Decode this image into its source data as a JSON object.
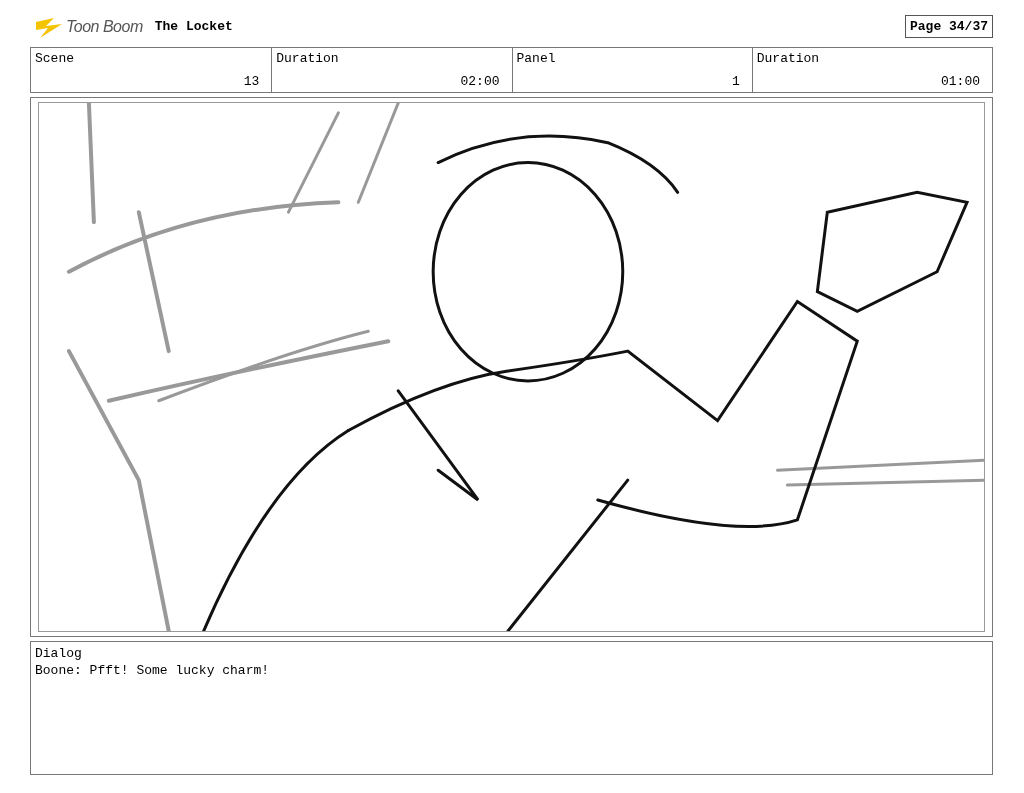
{
  "header": {
    "logo": "Toon Boom",
    "title": "The Locket",
    "page": "Page 34/37"
  },
  "info": [
    {
      "label": "Scene",
      "value": "13"
    },
    {
      "label": "Duration",
      "value": "02:00"
    },
    {
      "label": "Panel",
      "value": "1"
    },
    {
      "label": "Duration",
      "value": "01:00"
    }
  ],
  "dialog": {
    "label": "Dialog",
    "text": "Boone: Pfft! Some lucky charm!"
  }
}
